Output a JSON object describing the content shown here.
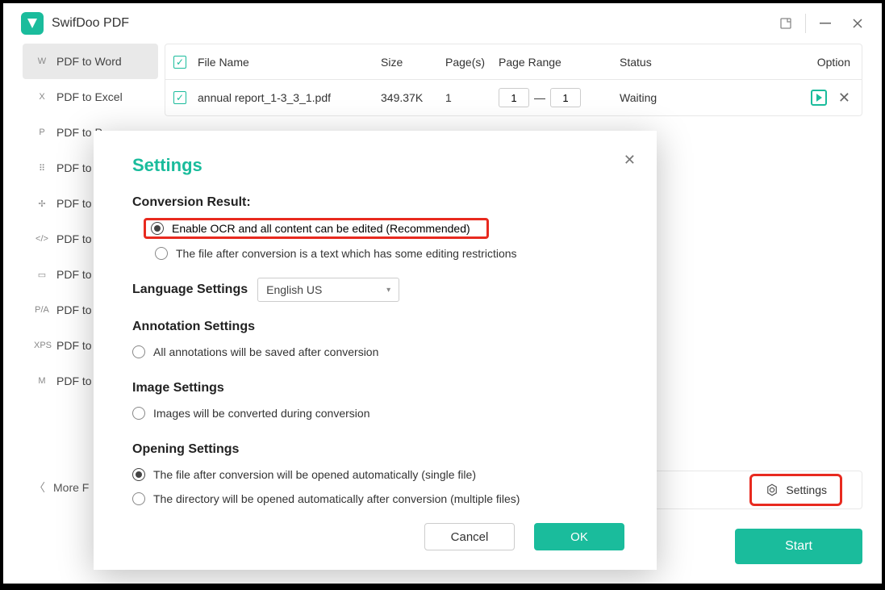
{
  "app": {
    "title": "SwifDoo PDF"
  },
  "sidebar": {
    "items": [
      {
        "icon": "W",
        "label": "PDF to Word",
        "active": true
      },
      {
        "icon": "X",
        "label": "PDF to Excel"
      },
      {
        "icon": "P",
        "label": "PDF to P"
      },
      {
        "icon": "⠿",
        "label": "PDF to I"
      },
      {
        "icon": "✢",
        "label": "PDF to C"
      },
      {
        "icon": "</>",
        "label": "PDF to H"
      },
      {
        "icon": "▭",
        "label": "PDF to E"
      },
      {
        "icon": "P/A",
        "label": "PDF to P"
      },
      {
        "icon": "XPS",
        "label": "PDF to X"
      },
      {
        "icon": "M",
        "label": "PDF to M"
      }
    ],
    "more": "More F"
  },
  "table": {
    "headers": {
      "name": "File Name",
      "size": "Size",
      "pages": "Page(s)",
      "range": "Page Range",
      "status": "Status",
      "option": "Option"
    },
    "rows": [
      {
        "name": "annual report_1-3_3_1.pdf",
        "size": "349.37K",
        "pages": "1",
        "range_from": "1",
        "range_to": "1",
        "status": "Waiting"
      }
    ]
  },
  "footer": {
    "settings": "Settings",
    "start": "Start"
  },
  "dialog": {
    "title": "Settings",
    "conversion": {
      "heading": "Conversion Result:",
      "opt1": "Enable OCR and all content can be edited (Recommended)",
      "opt2": "The file after conversion is a text which has some editing restrictions"
    },
    "language": {
      "heading": "Language Settings",
      "value": "English US"
    },
    "annotation": {
      "heading": "Annotation Settings",
      "opt1": "All annotations will be saved after conversion"
    },
    "image": {
      "heading": "Image Settings",
      "opt1": "Images will be converted during conversion"
    },
    "opening": {
      "heading": "Opening Settings",
      "opt1": "The file after conversion will be opened automatically (single file)",
      "opt2": "The directory will be opened automatically after conversion (multiple files)"
    },
    "buttons": {
      "cancel": "Cancel",
      "ok": "OK"
    }
  }
}
